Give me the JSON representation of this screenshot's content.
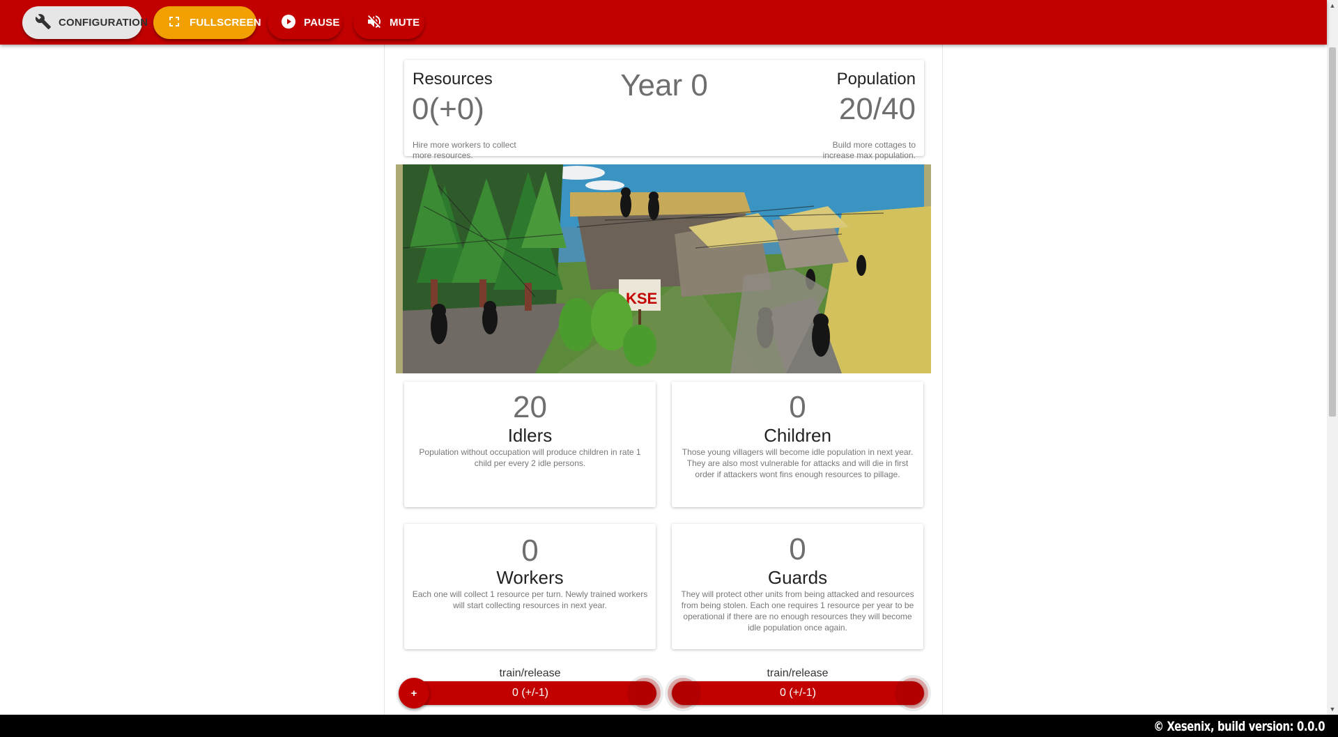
{
  "toolbar": {
    "configuration_label": "CONFIGURATION",
    "fullscreen_label": "FULLSCREEN",
    "pause_label": "PAUSE",
    "mute_label": "MUTE",
    "icons": [
      "wrench-icon",
      "fullscreen-icon",
      "play-circle-icon",
      "volume-off-icon"
    ]
  },
  "stats": {
    "resources_title": "Resources",
    "resources_value": "0(+0)",
    "resources_hint": "Hire more workers to collect more resources.",
    "year": "Year 0",
    "population_title": "Population",
    "population_value": "20/40",
    "population_hint": "Build more cottages to increase max population."
  },
  "scene": {
    "sign_text": "KSE"
  },
  "units": {
    "idlers": {
      "count": "20",
      "name": "Idlers",
      "description": "Population without occupation will produce children in rate 1 child per every 2 idle persons."
    },
    "children": {
      "count": "0",
      "name": "Children",
      "description": "Those young villagers will become idle population in next year. They are also most vulnerable for attacks and will die in first order if attackers wont fins enough resources to pillage."
    },
    "workers": {
      "count": "0",
      "name": "Workers",
      "description": "Each one will collect 1 resource per turn. Newly trained workers will start collecting resources in next year."
    },
    "guards": {
      "count": "0",
      "name": "Guards",
      "description": "They will protect other units from being attacked and resources from being stolen. Each one requires 1 resource per year to be operational if there are no enough resources they will become idle population once again."
    }
  },
  "train": {
    "workers": {
      "label": "train/release",
      "value": "0 (+/-1)",
      "plus": "+"
    },
    "guards": {
      "label": "train/release",
      "value": "0 (+/-1)"
    }
  },
  "footer": {
    "text": "© Xesenix, build version: 0.0.0"
  },
  "colors": {
    "primary_red": "#c20000",
    "fullscreen_amber": "#f0a000",
    "config_grey": "#e6e6e6",
    "footer_black": "#000000"
  }
}
